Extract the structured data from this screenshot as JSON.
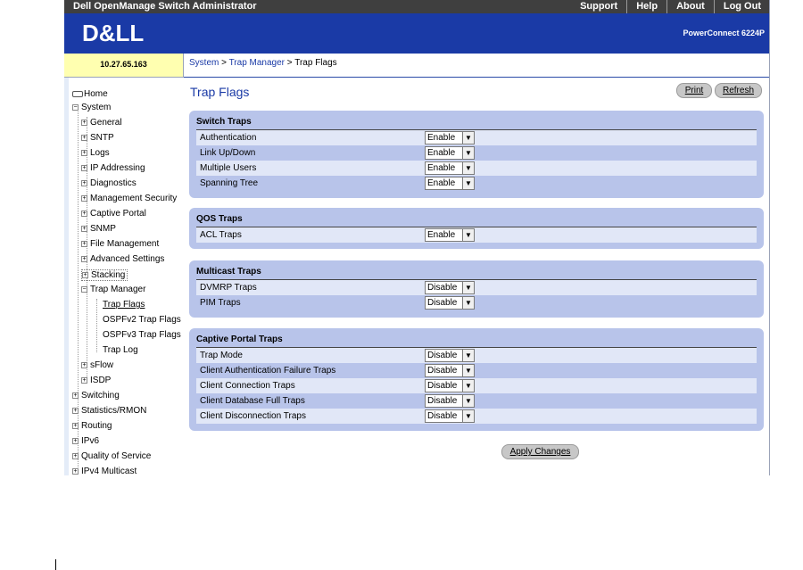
{
  "topbar": {
    "app_title": "Dell OpenManage Switch Administrator",
    "menu": [
      "Support",
      "Help",
      "About",
      "Log Out"
    ]
  },
  "brand": {
    "logo": "D&LL",
    "model": "PowerConnect 6224P"
  },
  "ip": "10.27.65.163",
  "breadcrumb": {
    "crumb1": "System",
    "sep1": " > ",
    "crumb2": "Trap Manager",
    "sep2": " > ",
    "current": "Trap Flags"
  },
  "nav": {
    "home": "Home",
    "system": "System",
    "general": "General",
    "sntp": "SNTP",
    "logs": "Logs",
    "ip_addressing": "IP Addressing",
    "diagnostics": "Diagnostics",
    "management_security": "Management Security",
    "captive_portal": "Captive Portal",
    "snmp": "SNMP",
    "file_management": "File Management",
    "advanced_settings": "Advanced Settings",
    "stacking": "Stacking",
    "trap_manager": "Trap Manager",
    "trap_flags": "Trap Flags",
    "ospfv2_trap_flags": "OSPFv2 Trap Flags",
    "ospfv3_trap_flags": "OSPFv3 Trap Flags",
    "trap_log": "Trap Log",
    "sflow": "sFlow",
    "isdp": "ISDP",
    "switching": "Switching",
    "statistics_rmon": "Statistics/RMON",
    "routing": "Routing",
    "ipv6": "IPv6",
    "quality_of_service": "Quality of Service",
    "ipv4_multicast": "IPv4 Multicast"
  },
  "page": {
    "title": "Trap Flags",
    "print": "Print",
    "refresh": "Refresh",
    "apply": "Apply Changes"
  },
  "sections": {
    "switch": {
      "title": "Switch Traps",
      "rows": [
        {
          "label": "Authentication",
          "value": "Enable"
        },
        {
          "label": "Link Up/Down",
          "value": "Enable"
        },
        {
          "label": "Multiple Users",
          "value": "Enable"
        },
        {
          "label": "Spanning Tree",
          "value": "Enable"
        }
      ]
    },
    "qos": {
      "title": "QOS Traps",
      "rows": [
        {
          "label": "ACL Traps",
          "value": "Enable"
        }
      ]
    },
    "multicast": {
      "title": "Multicast Traps",
      "rows": [
        {
          "label": "DVMRP Traps",
          "value": "Disable"
        },
        {
          "label": "PIM Traps",
          "value": "Disable"
        }
      ]
    },
    "captive": {
      "title": "Captive Portal Traps",
      "rows": [
        {
          "label": "Trap Mode",
          "value": "Disable"
        },
        {
          "label": "Client Authentication Failure Traps",
          "value": "Disable"
        },
        {
          "label": "Client Connection Traps",
          "value": "Disable"
        },
        {
          "label": "Client Database Full Traps",
          "value": "Disable"
        },
        {
          "label": "Client Disconnection Traps",
          "value": "Disable"
        }
      ]
    }
  },
  "colors": {
    "brand_blue": "#1a3aa6",
    "section_bg": "#b8c4ea",
    "row_alt": "#e1e7f7",
    "ip_bg": "#ffffb0"
  }
}
